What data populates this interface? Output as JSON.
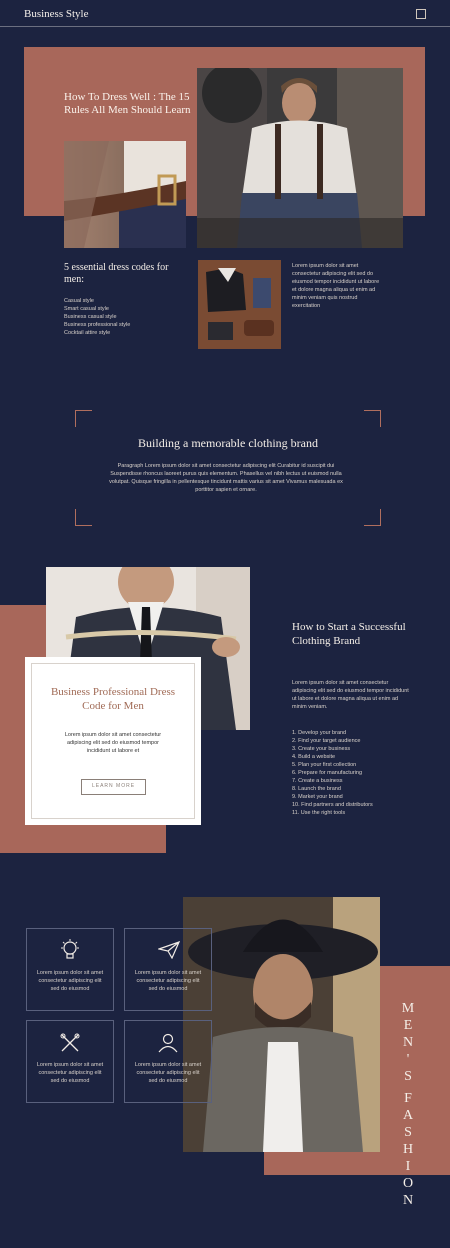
{
  "header": {
    "brand": "Business Style"
  },
  "hero": {
    "title": "How To Dress Well : The 15 Rules All Men Should Learn",
    "essential_title": "5 essential dress codes for men:",
    "essential_items": [
      "Casual style",
      "Smart casual style",
      "Business casual style",
      "Business professional style",
      "Cocktail attire style"
    ],
    "side_text": "Lorem ipsum dolor sit amet consectetur adipiscing elit sed do eiusmod tempor incididunt ut labore et dolore magna aliqua ut enim ad minim veniam quis nostrud exercitation"
  },
  "brand_block": {
    "title": "Building a memorable clothing brand",
    "body": "Paragraph Lorem ipsum dolor sit amet consectetur adipiscing elit Curabitur id suscipit dui Suspendisse rhoncus laoreet purus quis elementum. Phasellus vel nibh lectus ut euismod nulla volutpat. Quisque fringilla in pellentesque tincidunt mattis varius sit amet Vivamus malesuada ex porttitor sapien et ornare."
  },
  "section2": {
    "card_title": "Business Professional Dress Code for Men",
    "card_text": "Lorem ipsum dolor sit amet consectetur adipiscing elit sed do eiusmod tempor incididunt ut labore et",
    "card_button": "LEARN MORE",
    "right_title": "How to Start a Successful Clothing Brand",
    "right_intro": "Lorem ipsum dolor sit amet consectetur adipiscing elit sed do eiusmod tempor incididunt ut labore et dolore magna aliqua ut enim ad minim veniam.",
    "steps": [
      "1. Develop your brand",
      "2. Find your target audience",
      "3. Create your business",
      "4. Build a website",
      "5. Plan your first collection",
      "6. Prepare for manufacturing",
      "7. Create a business",
      "8. Launch the brand",
      "9. Market your brand",
      "10. Find partners and distributors",
      "11. Use the right tools"
    ]
  },
  "section3": {
    "cards": [
      {
        "icon": "lightbulb-icon",
        "text": "Lorem ipsum dolor sit amet consectetur adipiscing elit sed do eiusmod"
      },
      {
        "icon": "paper-plane-icon",
        "text": "Lorem ipsum dolor sit amet consectetur adipiscing elit sed do eiusmod"
      },
      {
        "icon": "crossed-tools-icon",
        "text": "Lorem ipsum dolor sit amet consectetur adipiscing elit sed do eiusmod"
      },
      {
        "icon": "users-icon",
        "text": "Lorem ipsum dolor sit amet consectetur adipiscing elit sed do eiusmod"
      }
    ],
    "vertical_text_1": "MEN'S",
    "vertical_text_2": "FASHION"
  },
  "colors": {
    "navy": "#1c2340",
    "copper": "#a8675a",
    "cream": "#f2ece6"
  }
}
